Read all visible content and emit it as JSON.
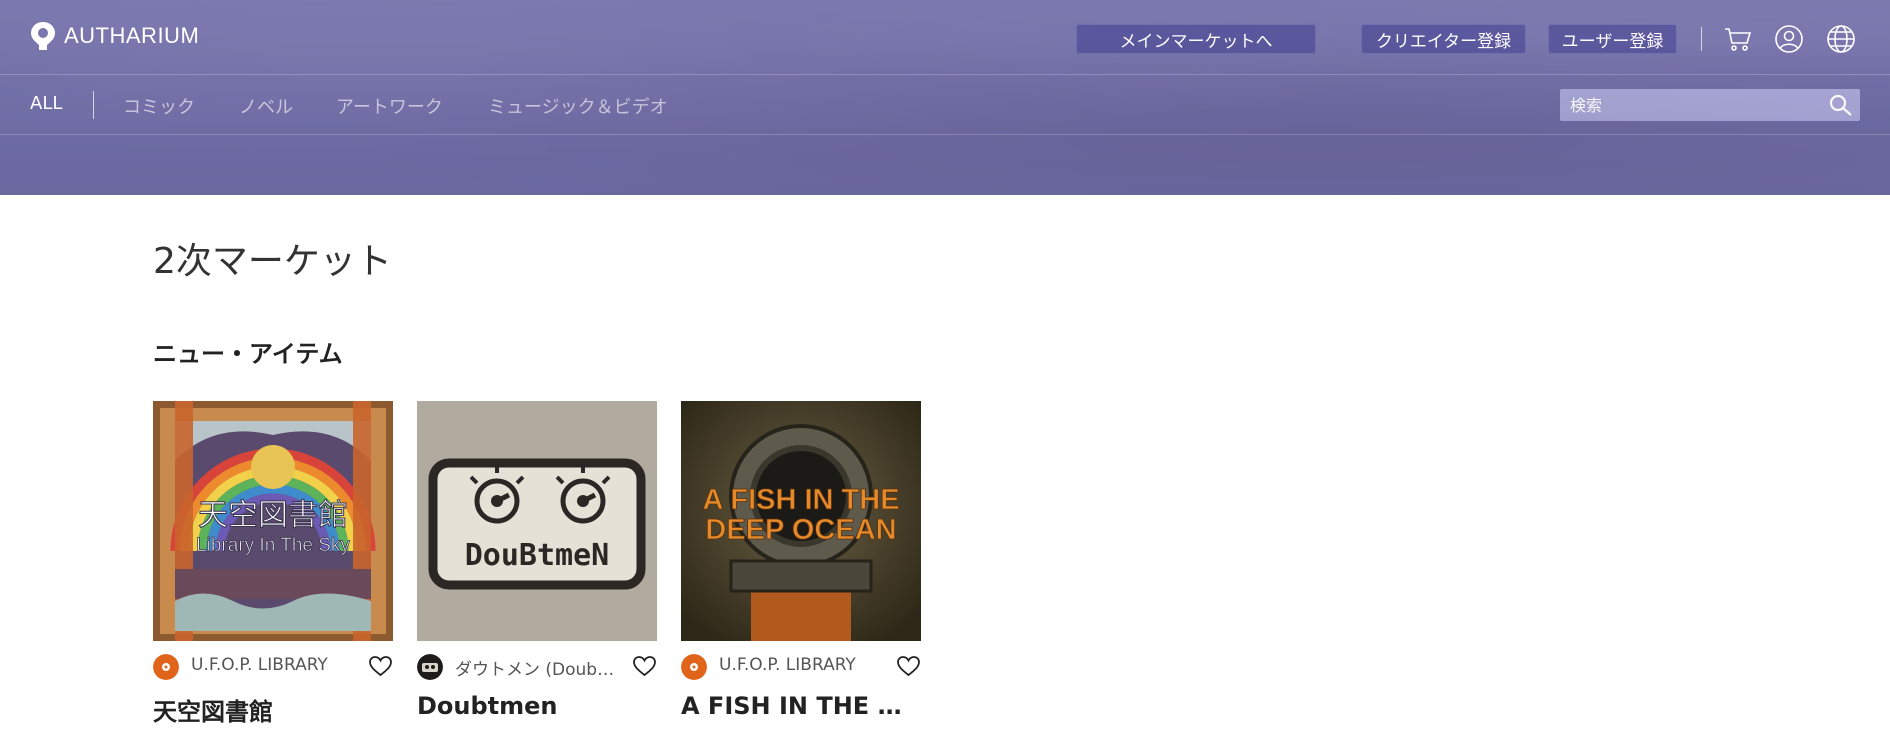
{
  "brand": {
    "name": "AUTHARIUM"
  },
  "header": {
    "main_market_label": "メインマーケットへ",
    "creator_register_label": "クリエイター登録",
    "user_register_label": "ユーザー登録",
    "icons": [
      "cart-icon",
      "user-icon",
      "globe-icon"
    ]
  },
  "nav": {
    "items": [
      {
        "label": "ALL",
        "active": true
      },
      {
        "label": "コミック"
      },
      {
        "label": "ノベル"
      },
      {
        "label": "アートワーク"
      },
      {
        "label": "ミュージック＆ビデオ"
      }
    ],
    "search_placeholder": "検索"
  },
  "page": {
    "title": "2次マーケット",
    "section_title": "ニュー・アイテム"
  },
  "items": [
    {
      "creator": "U.F.O.P. LIBRARY",
      "title": "天空図書館",
      "cover_text_jp": "天空図書館",
      "cover_text_en": "Library In The Sky"
    },
    {
      "creator": "ダウトメン (Doubtmen)",
      "title": "Doubtmen",
      "cover_text": "DouBtmeN"
    },
    {
      "creator": "U.F.O.P. LIBRARY",
      "title": "A FISH IN THE DEEP OCEAN",
      "cover_line1": "A FISH IN THE",
      "cover_line2": "DEEP OCEAN"
    }
  ],
  "colors": {
    "header_bg": "#7472aa",
    "button_bg": "#54519a",
    "search_bg": "#a6a5d6",
    "avatar_orange": "#e0651b"
  }
}
